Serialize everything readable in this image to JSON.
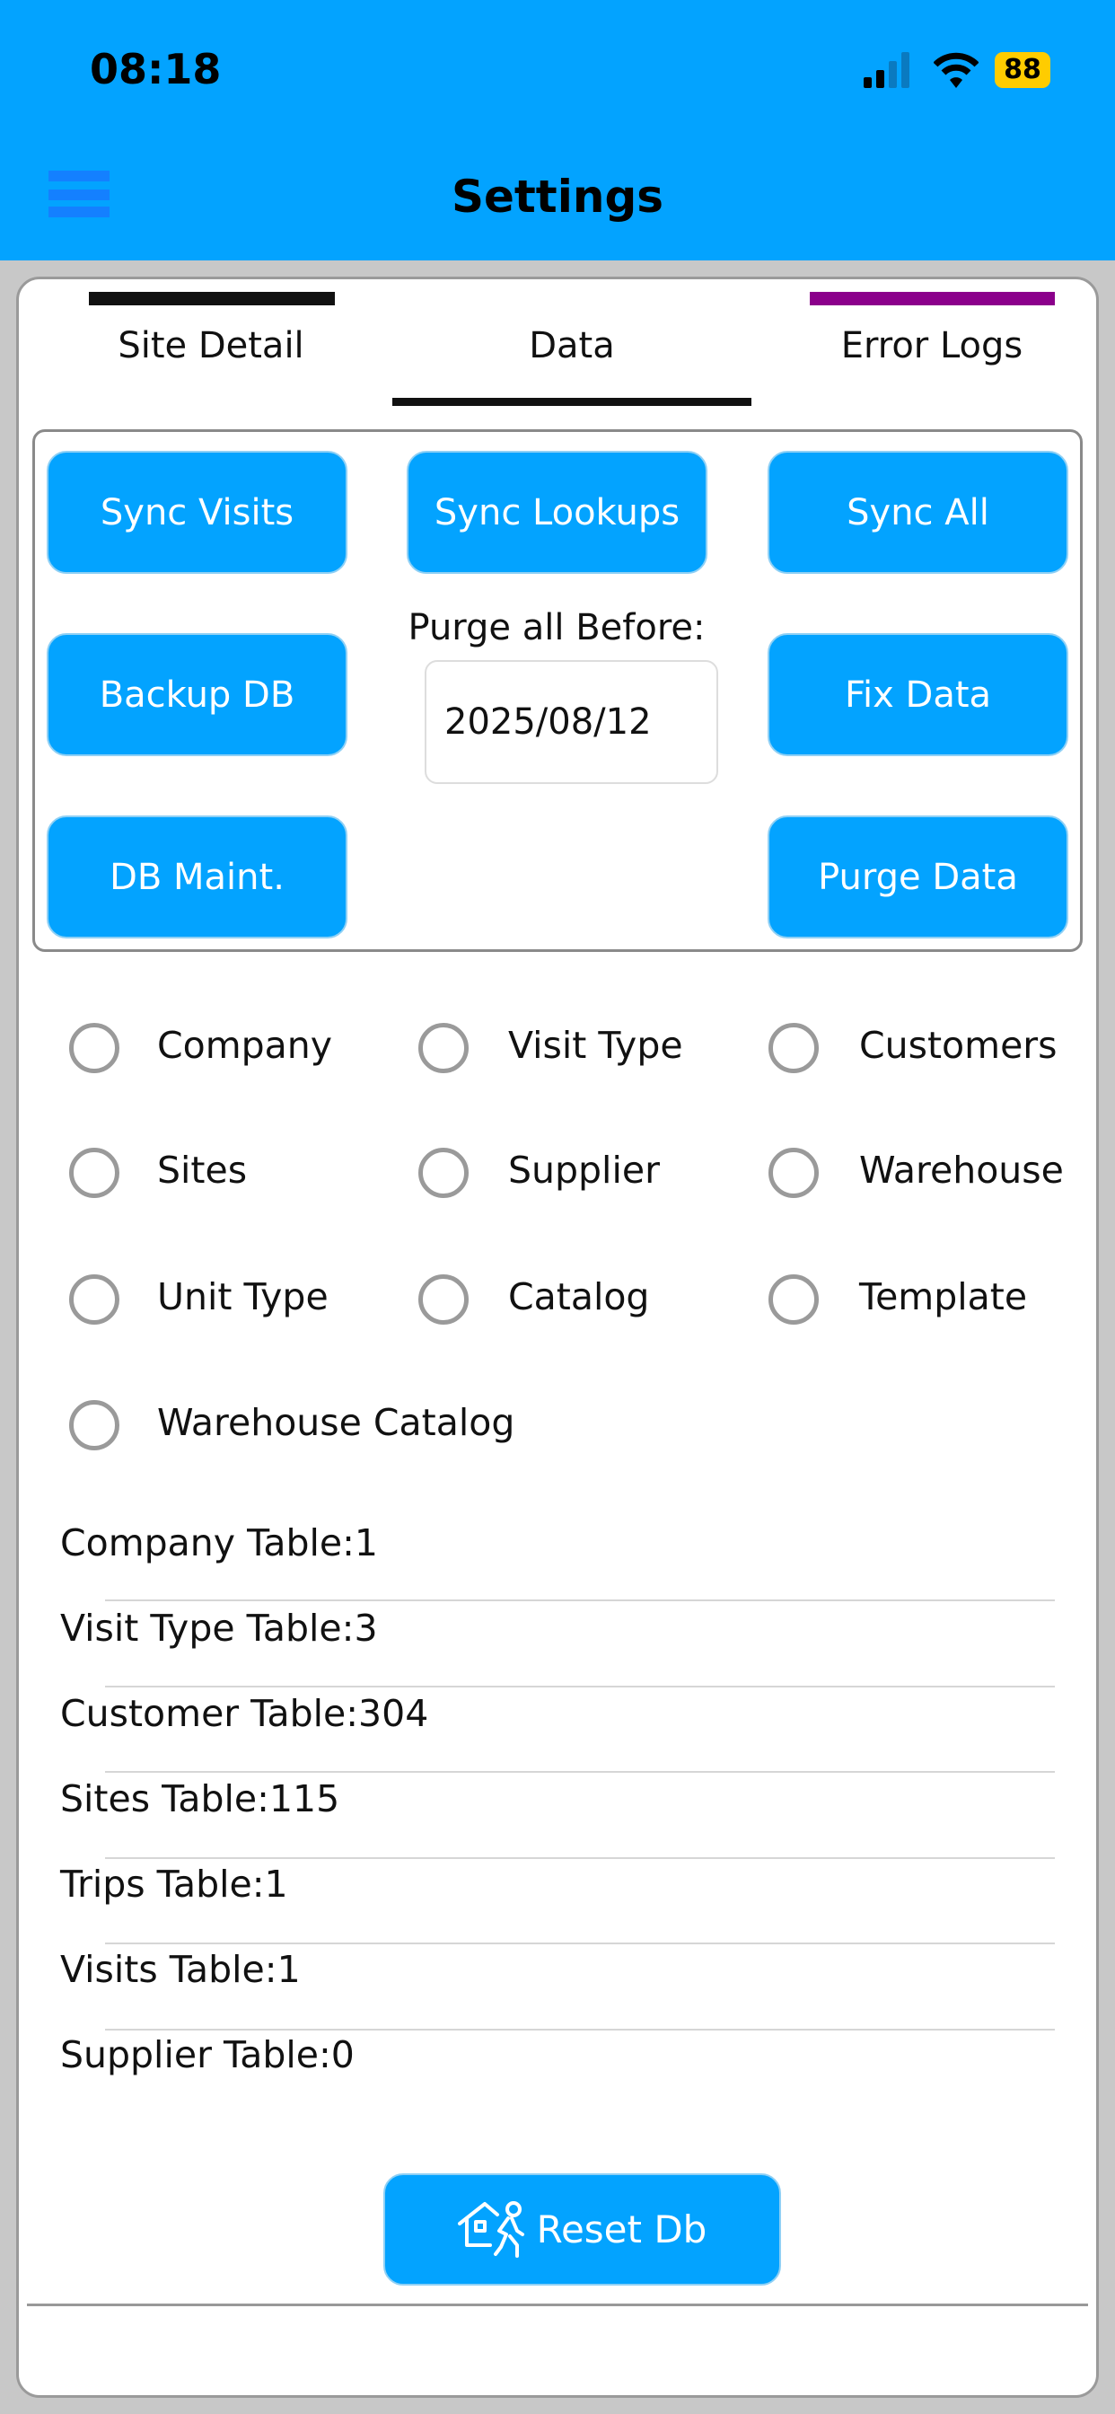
{
  "status_bar": {
    "time": "08:18",
    "battery": "88"
  },
  "header": {
    "title": "Settings"
  },
  "tabs": [
    {
      "label": "Site Detail"
    },
    {
      "label": "Data"
    },
    {
      "label": "Error Logs"
    }
  ],
  "actions": {
    "sync_visits": "Sync Visits",
    "sync_lookups": "Sync Lookups",
    "sync_all": "Sync All",
    "backup_db": "Backup DB",
    "fix_data": "Fix Data",
    "db_maint": "DB Maint.",
    "purge_data": "Purge Data",
    "purge_label": "Purge all Before:",
    "purge_date": "2025/08/12"
  },
  "options": [
    {
      "label": "Company"
    },
    {
      "label": "Visit Type"
    },
    {
      "label": "Customers"
    },
    {
      "label": "Sites"
    },
    {
      "label": "Supplier"
    },
    {
      "label": "Warehouse"
    },
    {
      "label": "Unit Type"
    },
    {
      "label": "Catalog"
    },
    {
      "label": "Template"
    },
    {
      "label": "Warehouse Catalog"
    }
  ],
  "tables": [
    {
      "text": "Company Table:1"
    },
    {
      "text": "Visit Type Table:3"
    },
    {
      "text": "Customer Table:304"
    },
    {
      "text": "Sites Table:115"
    },
    {
      "text": "Trips Table:1"
    },
    {
      "text": "Visits Table:1"
    },
    {
      "text": "Supplier Table:0"
    }
  ],
  "reset_label": "Reset Db",
  "colors": {
    "accent": "#03a3ff",
    "tab_indicator_left": "#111111",
    "tab_indicator_right": "#8b008b"
  }
}
